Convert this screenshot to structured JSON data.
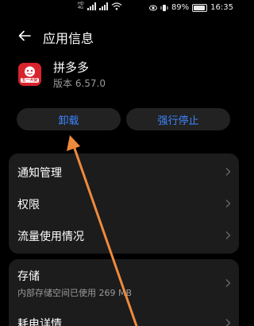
{
  "status_bar": {
    "net_tag_top": "HD",
    "net_tag_bottom": "4G",
    "battery_percent": "89%",
    "time": "16:35"
  },
  "header": {
    "title": "应用信息"
  },
  "app": {
    "name": "拼多多",
    "version": "版本 6.57.0",
    "icon_badge_text": "五一大促",
    "brand_color": "#d9232d"
  },
  "actions": {
    "uninstall_label": "卸载",
    "force_stop_label": "强行停止",
    "accent_color": "#3d84ff"
  },
  "settings_group1": [
    {
      "label": "通知管理"
    },
    {
      "label": "权限"
    },
    {
      "label": "流量使用情况"
    }
  ],
  "settings_group2": [
    {
      "label": "存储",
      "sub": "内部存储空间已使用 269 MB"
    },
    {
      "label": "耗电详情"
    }
  ],
  "annotation": {
    "arrow_color": "#f08a3c",
    "icon": "pointer-arrow"
  }
}
